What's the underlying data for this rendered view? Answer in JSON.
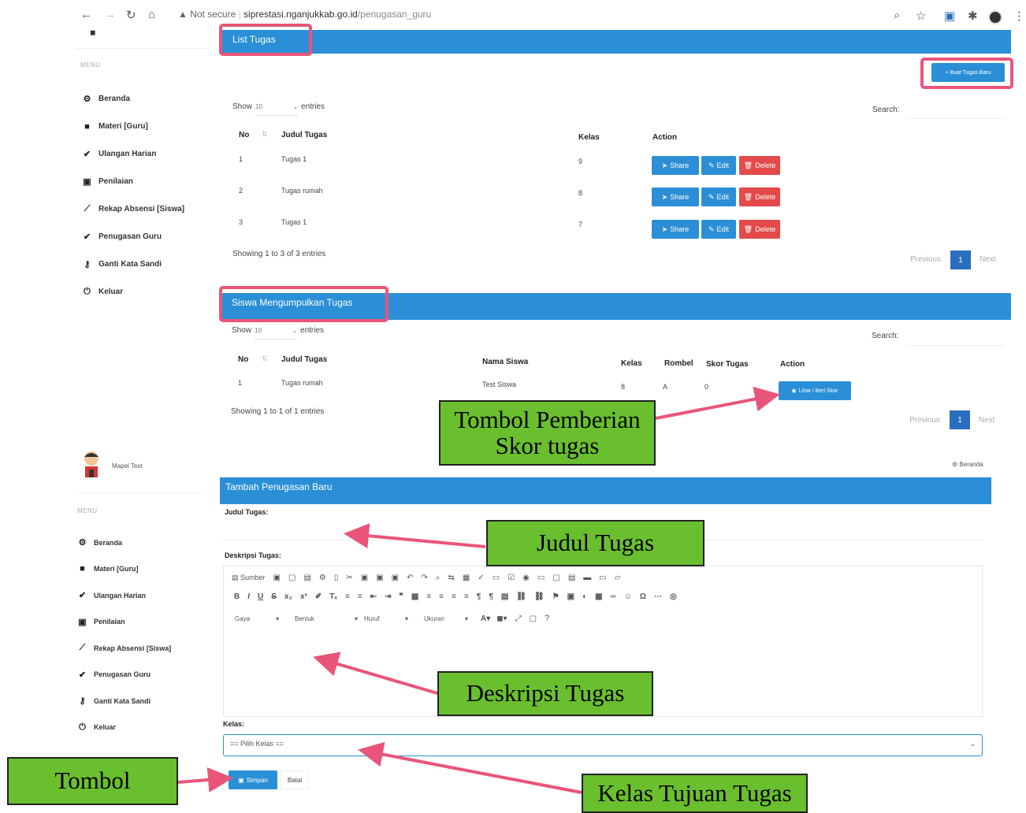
{
  "browser": {
    "security": "Not secure",
    "url_host": "siprestasi.nganjukkab.go.id",
    "url_path": "/penugasan_guru"
  },
  "sidebar_top": {
    "menu_label": "MENU",
    "items": [
      {
        "label": "Beranda",
        "icon": "dashboard-icon"
      },
      {
        "label": "Materi [Guru]",
        "icon": "book-icon"
      },
      {
        "label": "Ulangan Harian",
        "icon": "check-icon"
      },
      {
        "label": "Penilaian",
        "icon": "grade-icon"
      },
      {
        "label": "Rekap Absensi [Siswa]",
        "icon": "chart-icon"
      },
      {
        "label": "Penugasan Guru",
        "icon": "check-icon"
      },
      {
        "label": "Ganti Kata Sandi",
        "icon": "key-icon"
      },
      {
        "label": "Keluar",
        "icon": "power-icon"
      }
    ]
  },
  "list_tugas": {
    "title": "List Tugas",
    "new_button": "+ Buat Tugas Baru",
    "show": "Show",
    "entries_value": "10",
    "entries": "entries",
    "search": "Search:",
    "columns": [
      "No",
      "Judul Tugas",
      "Kelas",
      "Action"
    ],
    "rows": [
      {
        "no": "1",
        "judul": "Tugas 1",
        "kelas": "9"
      },
      {
        "no": "2",
        "judul": "Tugas rumah",
        "kelas": "8"
      },
      {
        "no": "3",
        "judul": "Tugas 1",
        "kelas": "7"
      }
    ],
    "share": "Share",
    "edit": "Edit",
    "delete": "Delete",
    "info": "Showing 1 to 3 of 3 entries",
    "prev": "Previous",
    "page": "1",
    "next": "Next"
  },
  "siswa": {
    "title": "Siswa Mengumpulkan Tugas",
    "show": "Show",
    "entries_value": "10",
    "entries": "entries",
    "search": "Search:",
    "columns": [
      "No",
      "Judul Tugas",
      "Nama Siswa",
      "Kelas",
      "Rombel",
      "Skor Tugas",
      "Action"
    ],
    "rows": [
      {
        "no": "1",
        "judul": "Tugas rumah",
        "nama": "Test Siswa",
        "kelas": "8",
        "rombel": "A",
        "skor": "0"
      }
    ],
    "action_button": "Lihat / Beri Skor",
    "info": "Showing 1 to 1 of 1 entries",
    "prev": "Previous",
    "page": "1",
    "next": "Next"
  },
  "sidebar_bottom": {
    "profile_name": "Mapel Test",
    "menu_label": "MENU",
    "items": [
      {
        "label": "Beranda"
      },
      {
        "label": "Materi [Guru]"
      },
      {
        "label": "Ulangan Harian"
      },
      {
        "label": "Penilaian"
      },
      {
        "label": "Rekap Absensi [Siswa]"
      },
      {
        "label": "Penugasan Guru"
      },
      {
        "label": "Ganti Kata Sandi"
      },
      {
        "label": "Keluar"
      }
    ]
  },
  "form": {
    "breadcrumb": "Beranda",
    "title": "Tambah Penugasan Baru",
    "judul_label": "Judul Tugas:",
    "deskripsi_label": "Deskripsi Tugas:",
    "sumber": "Sumber",
    "gaya": "Gaya",
    "bentuk": "Bentuk",
    "huruf": "Huruf",
    "ukuran": "Ukuran",
    "kelas_label": "Kelas:",
    "kelas_placeholder": "== Pilih Kelas ==",
    "simpan": "Simpan",
    "batal": "Batal"
  },
  "callouts": {
    "skor": "Tombol Pemberian Skor tugas",
    "judul": "Judul Tugas",
    "deskripsi": "Deskripsi Tugas",
    "tombol": "Tombol",
    "kelas": "Kelas Tujuan Tugas"
  },
  "colors": {
    "header_blue": "#2a8fd6",
    "highlight_pink": "#e95579",
    "callout_green": "#6abf2e",
    "arrow": "#e95579"
  }
}
